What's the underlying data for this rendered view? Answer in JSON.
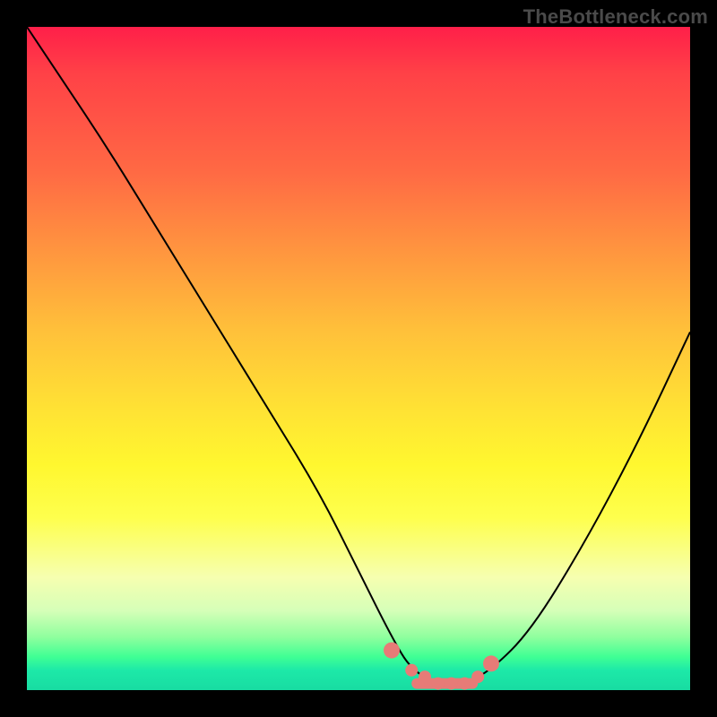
{
  "attribution": "TheBottleneck.com",
  "chart_data": {
    "type": "line",
    "title": "",
    "xlabel": "",
    "ylabel": "",
    "xlim": [
      0,
      100
    ],
    "ylim": [
      0,
      100
    ],
    "series": [
      {
        "name": "bottleneck-curve",
        "x": [
          0,
          4,
          12,
          20,
          28,
          36,
          44,
          50,
          55,
          58,
          62,
          66,
          70,
          76,
          84,
          92,
          100
        ],
        "y": [
          100,
          94,
          82,
          69,
          56,
          43,
          30,
          18,
          8,
          3,
          1,
          1,
          3,
          9,
          22,
          37,
          54
        ]
      },
      {
        "name": "optimal-markers",
        "x": [
          55,
          58,
          60,
          62,
          64,
          66,
          68,
          70
        ],
        "y": [
          6,
          3,
          2,
          1,
          1,
          1,
          2,
          4
        ]
      }
    ],
    "gradient_stops": [
      {
        "pos": 0,
        "color": "#ff1f49"
      },
      {
        "pos": 34,
        "color": "#ff963f"
      },
      {
        "pos": 66,
        "color": "#fff72f"
      },
      {
        "pos": 92,
        "color": "#8fff9e"
      },
      {
        "pos": 100,
        "color": "#18dca2"
      }
    ]
  }
}
